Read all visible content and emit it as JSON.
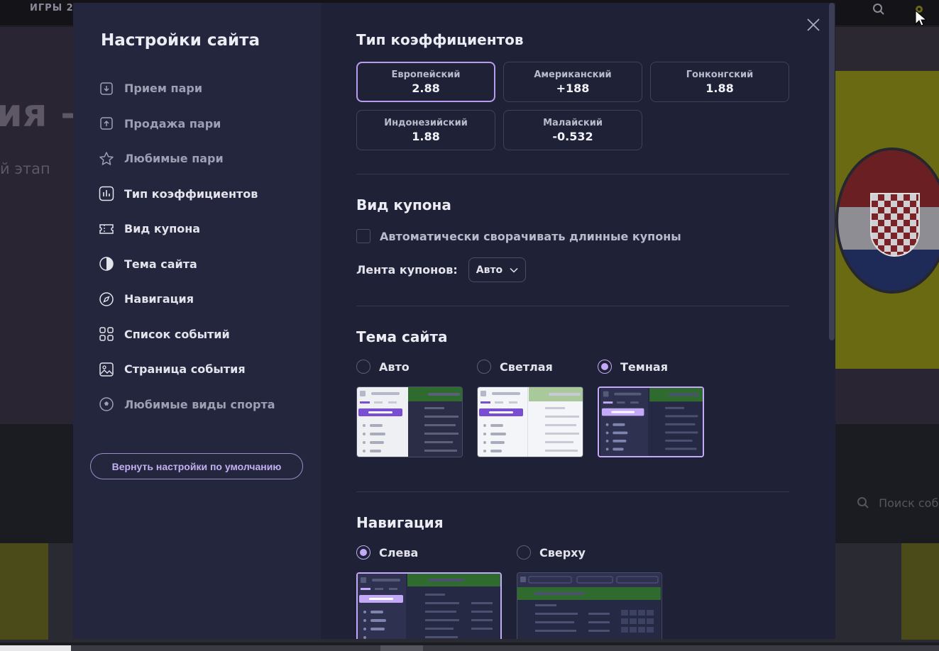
{
  "background": {
    "games_label": "ИГРЫ 2",
    "hero_big": "ия –",
    "hero_stage": "й этап",
    "search_placeholder": "Поиск соб"
  },
  "sidebar": {
    "title": "Настройки сайта",
    "items": [
      {
        "label": "Прием пари",
        "icon": "download-icon",
        "dim": true
      },
      {
        "label": "Продажа пари",
        "icon": "upload-icon",
        "dim": true
      },
      {
        "label": "Любимые пари",
        "icon": "star-icon",
        "dim": true
      },
      {
        "label": "Тип коэффициентов",
        "icon": "chart-icon",
        "dim": false
      },
      {
        "label": "Вид купона",
        "icon": "ticket-icon",
        "dim": false
      },
      {
        "label": "Тема сайта",
        "icon": "contrast-icon",
        "dim": false
      },
      {
        "label": "Навигация",
        "icon": "compass-icon",
        "dim": false
      },
      {
        "label": "Список событий",
        "icon": "grid-icon",
        "dim": false
      },
      {
        "label": "Страница события",
        "icon": "image-icon",
        "dim": false
      },
      {
        "label": "Любимые виды спорта",
        "icon": "ball-icon",
        "dim": true
      }
    ],
    "reset_label": "Вернуть настройки по умолчанию"
  },
  "odds": {
    "title": "Тип коэффициентов",
    "options": [
      {
        "name": "Европейский",
        "value": "2.88",
        "selected": true
      },
      {
        "name": "Американский",
        "value": "+188",
        "selected": false
      },
      {
        "name": "Гонконгский",
        "value": "1.88",
        "selected": false
      },
      {
        "name": "Индонезийский",
        "value": "1.88",
        "selected": false
      },
      {
        "name": "Малайский",
        "value": "-0.532",
        "selected": false
      }
    ]
  },
  "coupon": {
    "title": "Вид купона",
    "auto_collapse_label": "Автоматически сворачивать длинные купоны",
    "auto_collapse_checked": false,
    "feed_label": "Лента купонов:",
    "feed_value": "Авто"
  },
  "theme": {
    "title": "Тема сайта",
    "options": [
      {
        "label": "Авто",
        "selected": false
      },
      {
        "label": "Светлая",
        "selected": false
      },
      {
        "label": "Темная",
        "selected": true
      }
    ]
  },
  "navigation": {
    "title": "Навигация",
    "options": [
      {
        "label": "Слева",
        "selected": true
      },
      {
        "label": "Сверху",
        "selected": false
      }
    ]
  },
  "colors": {
    "accent": "#c3a9f7",
    "modal_bg": "#1f2236",
    "sidebar_bg": "#23263d"
  }
}
